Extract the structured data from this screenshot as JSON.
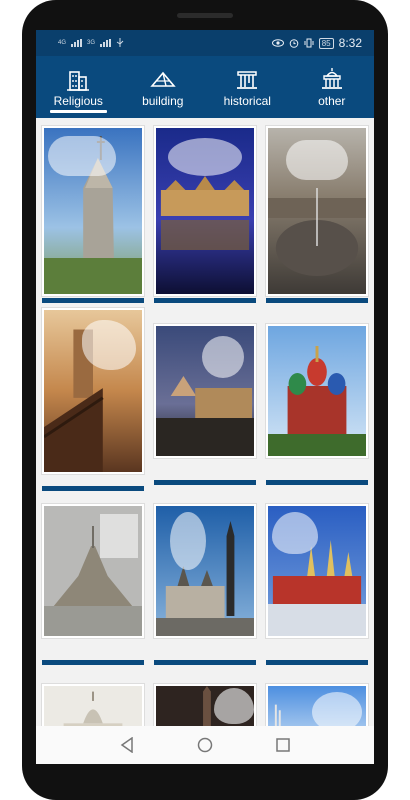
{
  "status": {
    "time": "8:32",
    "battery": "85",
    "sim1": "4G",
    "sim2": "3G"
  },
  "tabs": [
    {
      "label": "Religious",
      "icon": "buildings-icon",
      "active": true
    },
    {
      "label": "building",
      "icon": "pyramid-icon",
      "active": false
    },
    {
      "label": "historical",
      "icon": "ruins-icon",
      "active": false
    },
    {
      "label": "other",
      "icon": "capitol-icon",
      "active": false
    }
  ],
  "frames": [
    {
      "name": "frame-cathedral-spire",
      "shape": "cloud"
    },
    {
      "name": "frame-palace-night",
      "shape": "oval"
    },
    {
      "name": "frame-square-aerial",
      "shape": "cloud"
    },
    {
      "name": "frame-riverside-tower",
      "shape": "star"
    },
    {
      "name": "frame-louvre-dusk",
      "shape": "circle"
    },
    {
      "name": "frame-saint-basil",
      "shape": "none"
    },
    {
      "name": "frame-island-abbey",
      "shape": "square"
    },
    {
      "name": "frame-old-town",
      "shape": "oval"
    },
    {
      "name": "frame-kremlin",
      "shape": "heart"
    },
    {
      "name": "frame-basilica",
      "shape": "none"
    },
    {
      "name": "frame-dark-church",
      "shape": "heart"
    },
    {
      "name": "frame-blue-sky",
      "shape": "oval"
    }
  ],
  "colors": {
    "statusbar": "#0a3f6c",
    "tabbar": "#0a4a7e",
    "accent_bar": "#0a4a7e"
  }
}
